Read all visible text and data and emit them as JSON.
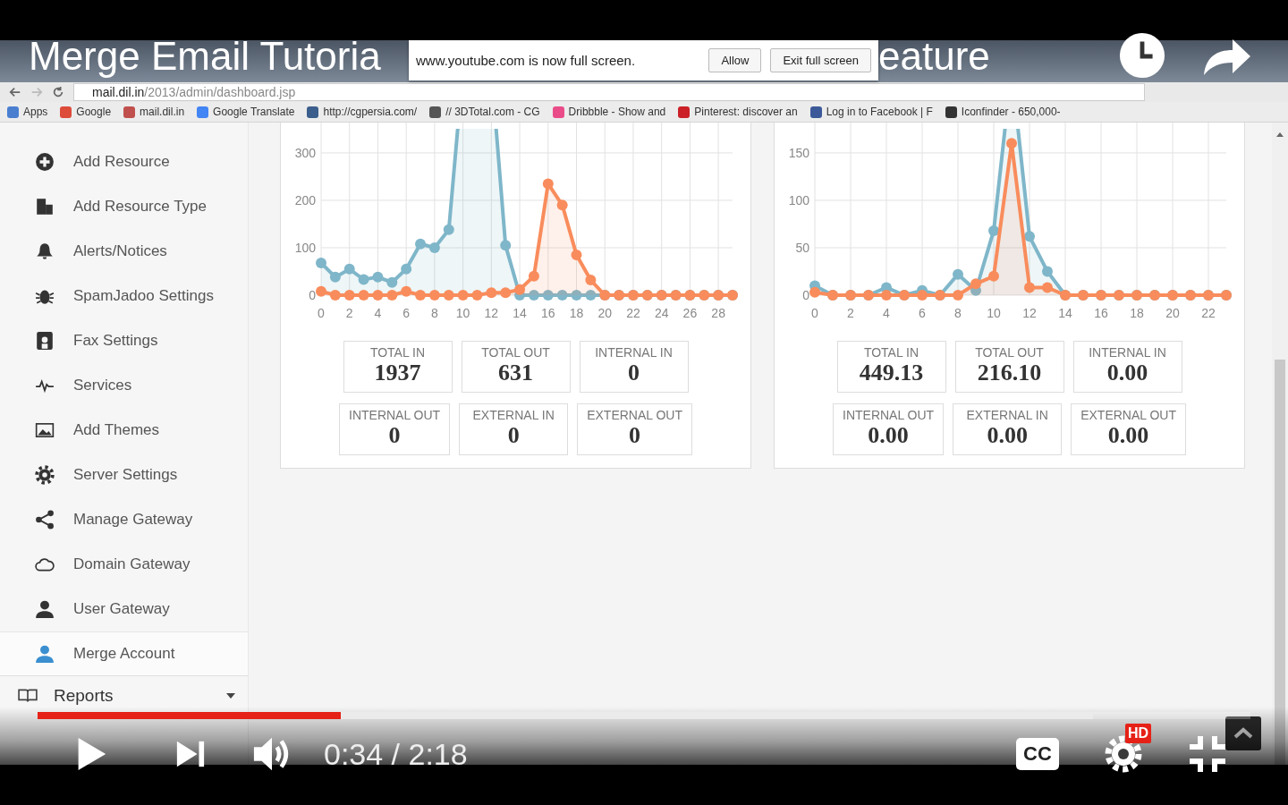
{
  "player": {
    "title_parts": [
      "Merge Email Tutoria",
      "eature"
    ],
    "time": "0:34 / 2:18",
    "cc_label": "CC",
    "hd_badge": "HD",
    "progress": {
      "level": 0.25
    },
    "buffer": {
      "level": 0.87
    }
  },
  "fullscreen_notice": {
    "text": "www.youtube.com is now full screen.",
    "buttons": [
      "Allow",
      "Exit full screen"
    ]
  },
  "browser": {
    "url_host": "mail.dil.in",
    "url_path": "/2013/admin/dashboard.jsp",
    "bookmarks": [
      {
        "label": "Apps",
        "color": "#4a7fd0"
      },
      {
        "label": "Google",
        "color": "#dd4b39"
      },
      {
        "label": "mail.dil.in",
        "color": "#c0504d"
      },
      {
        "label": "Google Translate",
        "color": "#4285f4"
      },
      {
        "label": "http://cgpersia.com/",
        "color": "#3b5e8c"
      },
      {
        "label": "// 3DTotal.com - CG",
        "color": "#555555"
      },
      {
        "label": "Dribbble - Show and",
        "color": "#ea4c89"
      },
      {
        "label": "Pinterest: discover an",
        "color": "#cb2027"
      },
      {
        "label": "Log in to Facebook | F",
        "color": "#3b5998"
      },
      {
        "label": "Iconfinder - 650,000-",
        "color": "#333333"
      }
    ]
  },
  "sidebar": {
    "items": [
      {
        "label": "Add Resource",
        "selected": false
      },
      {
        "label": "Add Resource Type",
        "selected": false
      },
      {
        "label": "Alerts/Notices",
        "selected": false
      },
      {
        "label": "SpamJadoo Settings",
        "selected": false
      },
      {
        "label": "Fax Settings",
        "selected": false
      },
      {
        "label": "Services",
        "selected": false
      },
      {
        "label": "Add Themes",
        "selected": false
      },
      {
        "label": "Server Settings",
        "selected": false
      },
      {
        "label": "Manage Gateway",
        "selected": false
      },
      {
        "label": "Domain Gateway",
        "selected": false
      },
      {
        "label": "User Gateway",
        "selected": false
      },
      {
        "label": "Merge Account",
        "selected": true
      }
    ],
    "section": {
      "label": "Reports"
    }
  },
  "panels": [
    {
      "chart_data": {
        "type": "area",
        "grid": true,
        "x": [
          0,
          1,
          2,
          3,
          4,
          5,
          6,
          7,
          8,
          9,
          10,
          11,
          12,
          13,
          14,
          15,
          16,
          17,
          18,
          19,
          20,
          21,
          22,
          23,
          24,
          25,
          26,
          27,
          28,
          29
        ],
        "xlim": [
          0,
          29
        ],
        "ylim": [
          0,
          364
        ],
        "xticks": [
          0,
          2,
          4,
          6,
          8,
          10,
          12,
          14,
          16,
          18,
          20,
          22,
          24,
          26,
          28
        ],
        "yticks": [
          0,
          100,
          200,
          300
        ],
        "series": [
          {
            "color": "#7fb6c9",
            "values": [
              68,
              38,
              55,
              33,
              38,
              27,
              55,
              108,
              100,
              138,
              null,
              null,
              null,
              105,
              0,
              0,
              0,
              0,
              0,
              0,
              0,
              0,
              0,
              0,
              0,
              0,
              0,
              0,
              0,
              0
            ]
          },
          {
            "color": "#f98c5c",
            "values": [
              8,
              0,
              0,
              0,
              0,
              0,
              8,
              0,
              0,
              0,
              0,
              0,
              5,
              5,
              12,
              40,
              235,
              190,
              85,
              32,
              0,
              0,
              0,
              0,
              0,
              0,
              0,
              0,
              0,
              0
            ]
          }
        ]
      },
      "stats": [
        {
          "label": "TOTAL IN",
          "value": "1937"
        },
        {
          "label": "TOTAL OUT",
          "value": "631"
        },
        {
          "label": "INTERNAL IN",
          "value": "0"
        },
        {
          "label": "INTERNAL OUT",
          "value": "0"
        },
        {
          "label": "EXTERNAL IN",
          "value": "0"
        },
        {
          "label": "EXTERNAL OUT",
          "value": "0"
        }
      ]
    },
    {
      "chart_data": {
        "type": "area",
        "grid": true,
        "x": [
          0,
          1,
          2,
          3,
          4,
          5,
          6,
          7,
          8,
          9,
          10,
          11,
          12,
          13,
          14,
          15,
          16,
          17,
          18,
          19,
          20,
          21,
          22,
          23
        ],
        "xlim": [
          0,
          23
        ],
        "ylim": [
          0,
          182
        ],
        "xticks": [
          0,
          2,
          4,
          6,
          8,
          10,
          12,
          14,
          16,
          18,
          20,
          22
        ],
        "yticks": [
          0,
          50,
          100,
          150
        ],
        "series": [
          {
            "color": "#7fb6c9",
            "values": [
              10,
              0,
              0,
              0,
              8,
              0,
              5,
              0,
              22,
              5,
              68,
              null,
              62,
              25,
              0,
              0,
              0,
              0,
              0,
              0,
              0,
              0,
              0,
              0
            ]
          },
          {
            "color": "#f98c5c",
            "values": [
              3,
              0,
              0,
              0,
              0,
              0,
              0,
              0,
              0,
              12,
              20,
              160,
              8,
              8,
              0,
              0,
              0,
              0,
              0,
              0,
              0,
              0,
              0,
              0
            ]
          }
        ]
      },
      "stats": [
        {
          "label": "TOTAL IN",
          "value": "449.13"
        },
        {
          "label": "TOTAL OUT",
          "value": "216.10"
        },
        {
          "label": "INTERNAL IN",
          "value": "0.00"
        },
        {
          "label": "INTERNAL OUT",
          "value": "0.00"
        },
        {
          "label": "EXTERNAL IN",
          "value": "0.00"
        },
        {
          "label": "EXTERNAL OUT",
          "value": "0.00"
        }
      ]
    }
  ]
}
